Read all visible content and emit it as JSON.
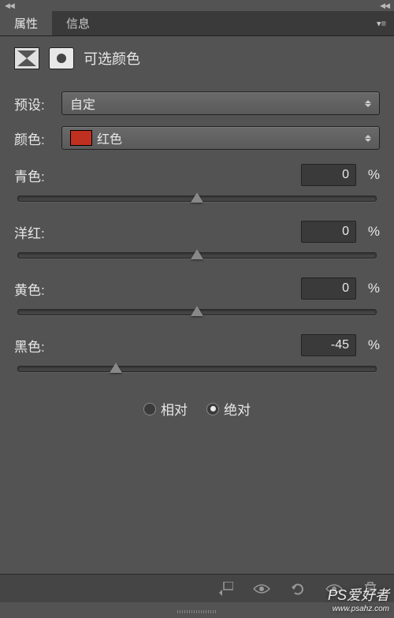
{
  "tabs": {
    "properties": "属性",
    "info": "信息"
  },
  "title": "可选颜色",
  "preset": {
    "label": "预设:",
    "value": "自定"
  },
  "color": {
    "label": "颜色:",
    "value": "红色",
    "swatch": "#c03020"
  },
  "sliders": {
    "cyan": {
      "label": "青色:",
      "value": "0",
      "unit": "%",
      "pos": 50
    },
    "magenta": {
      "label": "洋红:",
      "value": "0",
      "unit": "%",
      "pos": 50
    },
    "yellow": {
      "label": "黄色:",
      "value": "0",
      "unit": "%",
      "pos": 50
    },
    "black": {
      "label": "黑色:",
      "value": "-45",
      "unit": "%",
      "pos": 27.5
    }
  },
  "radios": {
    "relative": "相对",
    "absolute": "绝对",
    "selected": "absolute"
  },
  "watermark": {
    "main": "PS爱好者",
    "sub": "www.psahz.com"
  }
}
